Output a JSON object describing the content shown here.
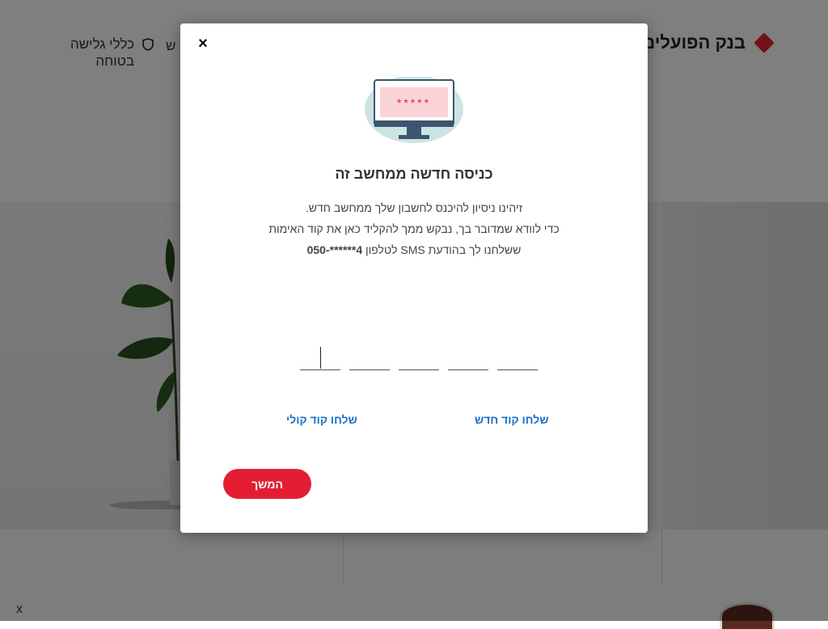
{
  "background": {
    "brand": {
      "name": "בנק הפועלים",
      "logo_color": "#e32430"
    },
    "nav": {
      "cut_item": "ש",
      "safe_browsing": "כללי גלישה בטוחה"
    },
    "bottom_close": "x"
  },
  "modal": {
    "close_label": "×",
    "illustration": {
      "password_mask": "*****"
    },
    "title": "כניסה חדשה ממחשב זה",
    "description": {
      "line1": "זיהינו ניסיון להיכנס לחשבון שלך ממחשב חדש.",
      "line2": "כדי לוודא שמדובר בך, נבקש ממך להקליד כאן את קוד האימות",
      "line3_prefix": "ששלחנו לך בהודעת SMS לטלפון",
      "phone": "050-******4"
    },
    "otp": {
      "digits": [
        "",
        "",
        "",
        "",
        ""
      ]
    },
    "links": {
      "resend_code": "שלחו קוד חדש",
      "voice_code": "שלחו קוד קולי"
    },
    "continue_label": "המשך",
    "colors": {
      "accent": "#e31e33",
      "link": "#1a6fc7"
    }
  }
}
